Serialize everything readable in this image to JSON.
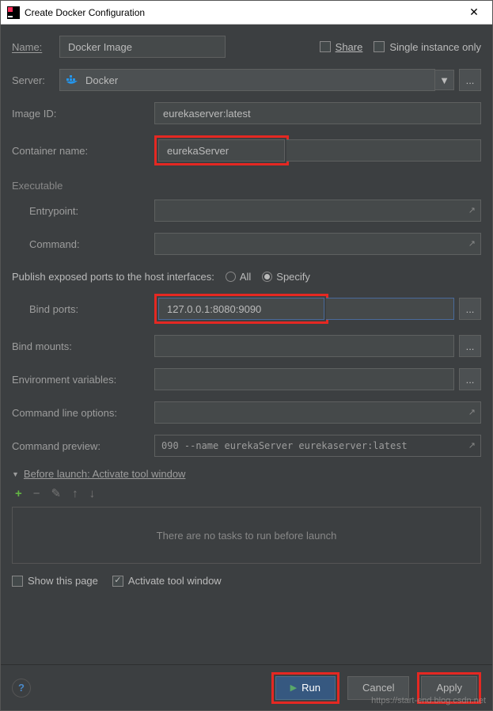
{
  "titlebar": {
    "title": "Create Docker Configuration"
  },
  "topRow": {
    "nameLabel": "Name:",
    "nameValue": "Docker Image",
    "shareLabel": "Share",
    "singleLabel": "Single instance only"
  },
  "server": {
    "label": "Server:",
    "value": "Docker",
    "ellipsis": "..."
  },
  "imageId": {
    "label": "Image ID:",
    "value": "eurekaserver:latest"
  },
  "container": {
    "label": "Container name:",
    "value": "eurekaServer"
  },
  "executable": {
    "title": "Executable",
    "entryLabel": "Entrypoint:",
    "entryValue": "",
    "cmdLabel": "Command:",
    "cmdValue": ""
  },
  "publish": {
    "label": "Publish exposed ports to the host interfaces:",
    "allLabel": "All",
    "specifyLabel": "Specify"
  },
  "bindPorts": {
    "label": "Bind ports:",
    "value": "127.0.0.1:8080:9090",
    "ellipsis": "..."
  },
  "bindMounts": {
    "label": "Bind mounts:",
    "value": "",
    "ellipsis": "..."
  },
  "envVars": {
    "label": "Environment variables:",
    "value": "",
    "ellipsis": "..."
  },
  "cmdLine": {
    "label": "Command line options:",
    "value": ""
  },
  "cmdPreview": {
    "label": "Command preview:",
    "value": "090 --name eurekaServer eurekaserver:latest"
  },
  "before": {
    "title": "Before launch: Activate tool window",
    "empty": "There are no tasks to run before launch",
    "showPage": "Show this page",
    "activate": "Activate tool window"
  },
  "footer": {
    "run": "Run",
    "cancel": "Cancel",
    "apply": "Apply"
  },
  "watermark": "https://start-end.blog.csdn.net"
}
